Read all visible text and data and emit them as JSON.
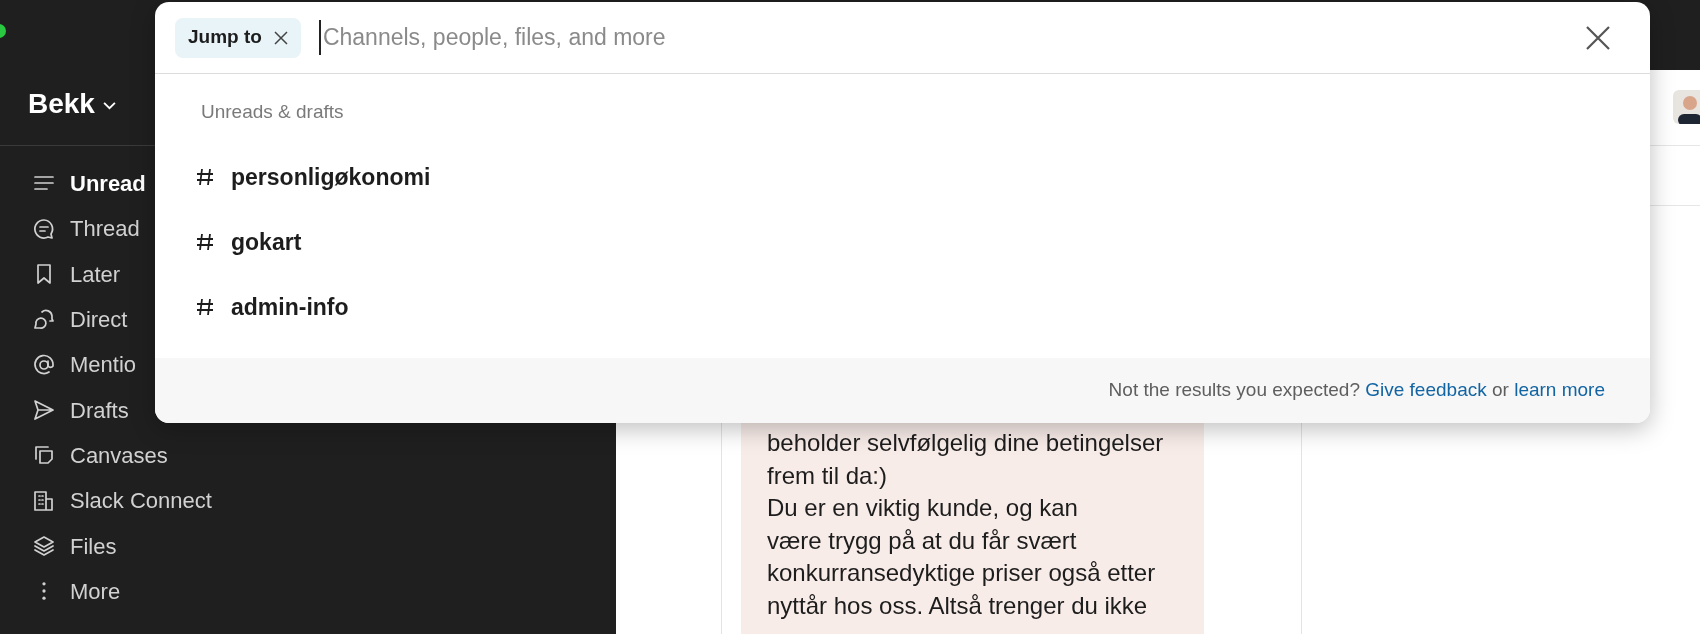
{
  "workspace": {
    "name": "Bekk"
  },
  "sidebar": {
    "items": [
      {
        "kind": "unreads",
        "label": "Unread",
        "selected": true
      },
      {
        "kind": "threads",
        "label": "Thread",
        "selected": false
      },
      {
        "kind": "later",
        "label": "Later",
        "selected": false
      },
      {
        "kind": "direct",
        "label": "Direct",
        "selected": false
      },
      {
        "kind": "mentions",
        "label": "Mentio",
        "selected": false
      },
      {
        "kind": "drafts",
        "label": "Drafts",
        "selected": false
      },
      {
        "kind": "canvases",
        "label": "Canvases",
        "selected": false
      },
      {
        "kind": "connect",
        "label": "Slack Connect",
        "selected": false
      },
      {
        "kind": "files",
        "label": "Files",
        "selected": false
      },
      {
        "kind": "more",
        "label": "More",
        "selected": false
      }
    ]
  },
  "jump_dialog": {
    "chip": "Jump to",
    "placeholder": "Channels, people, files, and more",
    "section": "Unreads & drafts",
    "results": [
      {
        "name": "personligøkonomi"
      },
      {
        "name": "gokart"
      },
      {
        "name": "admin-info"
      }
    ],
    "footer": {
      "question": "Not the results you expected?",
      "feedback_link": "Give feedback",
      "conjunction": "or",
      "learn_link": "learn more"
    }
  },
  "message": {
    "text": "beholder selvfølgelig dine betingelser\nfrem til da:)\nDu er en viktig kunde, og kan\nvære trygg på at du får svært\nkonkurransedyktige priser også etter\nnyttår hos oss. Altså trenger du ikke"
  }
}
